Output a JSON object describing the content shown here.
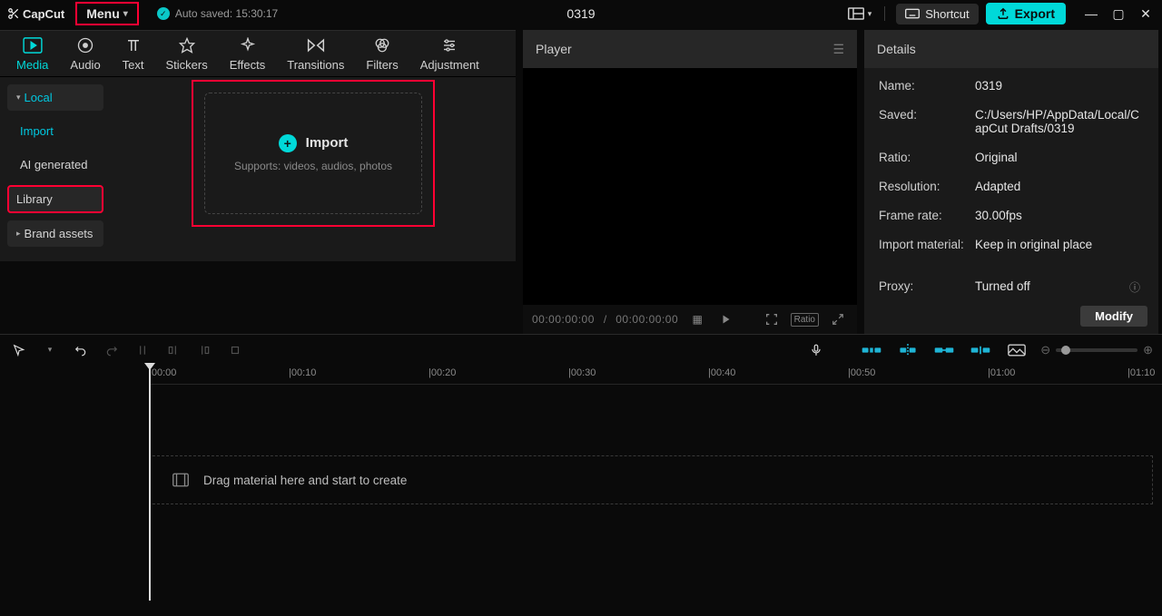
{
  "app": {
    "name": "CapCut",
    "project_title": "0319"
  },
  "header": {
    "menu_label": "Menu",
    "autosave_label": "Auto saved: 15:30:17",
    "shortcut_label": "Shortcut",
    "export_label": "Export"
  },
  "tabs": [
    {
      "id": "media",
      "label": "Media"
    },
    {
      "id": "audio",
      "label": "Audio"
    },
    {
      "id": "text",
      "label": "Text"
    },
    {
      "id": "stickers",
      "label": "Stickers"
    },
    {
      "id": "effects",
      "label": "Effects"
    },
    {
      "id": "transitions",
      "label": "Transitions"
    },
    {
      "id": "filters",
      "label": "Filters"
    },
    {
      "id": "adjustment",
      "label": "Adjustment"
    }
  ],
  "media_sidebar": {
    "items": [
      {
        "id": "local",
        "label": "Local"
      },
      {
        "id": "import",
        "label": "Import"
      },
      {
        "id": "ai",
        "label": "AI generated"
      },
      {
        "id": "library",
        "label": "Library"
      },
      {
        "id": "brand",
        "label": "Brand assets"
      }
    ]
  },
  "import_box": {
    "label": "Import",
    "sub": "Supports: videos, audios, photos"
  },
  "player": {
    "title": "Player",
    "time_current": "00:00:00:00",
    "time_total": "00:00:00:00",
    "ratio_label": "Ratio"
  },
  "details": {
    "title": "Details",
    "rows": {
      "name": {
        "label": "Name:",
        "value": "0319"
      },
      "saved": {
        "label": "Saved:",
        "value": "C:/Users/HP/AppData/Local/CapCut Drafts/0319"
      },
      "ratio": {
        "label": "Ratio:",
        "value": "Original"
      },
      "resolution": {
        "label": "Resolution:",
        "value": "Adapted"
      },
      "framerate": {
        "label": "Frame rate:",
        "value": "30.00fps"
      },
      "import_material": {
        "label": "Import material:",
        "value": "Keep in original place"
      },
      "proxy": {
        "label": "Proxy:",
        "value": "Turned off"
      }
    },
    "modify_label": "Modify"
  },
  "timeline": {
    "ruler_marks": [
      "|00:00",
      "|00:10",
      "|00:20",
      "|00:30",
      "|00:40",
      "|00:50",
      "|01:00",
      "|01:10"
    ],
    "drop_hint": "Drag material here and start to create"
  },
  "colors": {
    "accent": "#00d9d9",
    "highlight": "#ff0033"
  }
}
